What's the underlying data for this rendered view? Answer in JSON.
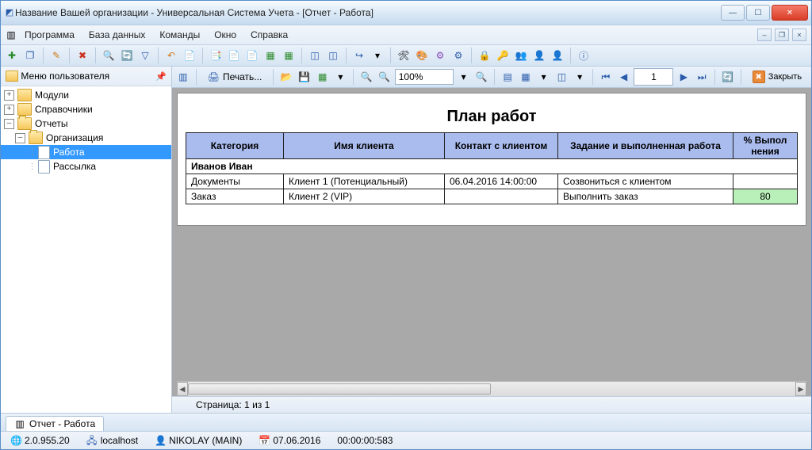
{
  "window": {
    "title": "Название Вашей организации - Универсальная Система Учета - [Отчет - Работа]"
  },
  "menu": {
    "program": "Программа",
    "database": "База данных",
    "commands": "Команды",
    "window": "Окно",
    "help": "Справка"
  },
  "sidebar": {
    "title": "Меню пользователя",
    "modules": "Модули",
    "refs": "Справочники",
    "reports": "Отчеты",
    "org": "Организация",
    "work": "Работа",
    "mailing": "Рассылка"
  },
  "report_tb": {
    "print": "Печать...",
    "zoom": "100%",
    "page": "1",
    "close": "Закрыть"
  },
  "report": {
    "title": "План работ",
    "headers": {
      "cat": "Категория",
      "client": "Имя клиента",
      "contact": "Контакт с клиентом",
      "task": "Задание и выполненная работа",
      "pct": "% Выпол нения"
    },
    "group": "Иванов Иван",
    "rows": [
      {
        "cat": "Документы",
        "client": "Клиент 1 (Потенциальный)",
        "contact": "06.04.2016 14:00:00",
        "task": "Созвониться с клиентом",
        "pct": ""
      },
      {
        "cat": "Заказ",
        "client": "Клиент 2 (VIP)",
        "contact": "",
        "task": "Выполнить заказ",
        "pct": "80"
      }
    ],
    "page_status": "Страница: 1 из 1"
  },
  "tabs": {
    "report_work": "Отчет - Работа"
  },
  "status": {
    "version": "2.0.955.20",
    "host": "localhost",
    "user": "NIKOLAY (MAIN)",
    "date": "07.06.2016",
    "time": "00:00:00:583"
  }
}
